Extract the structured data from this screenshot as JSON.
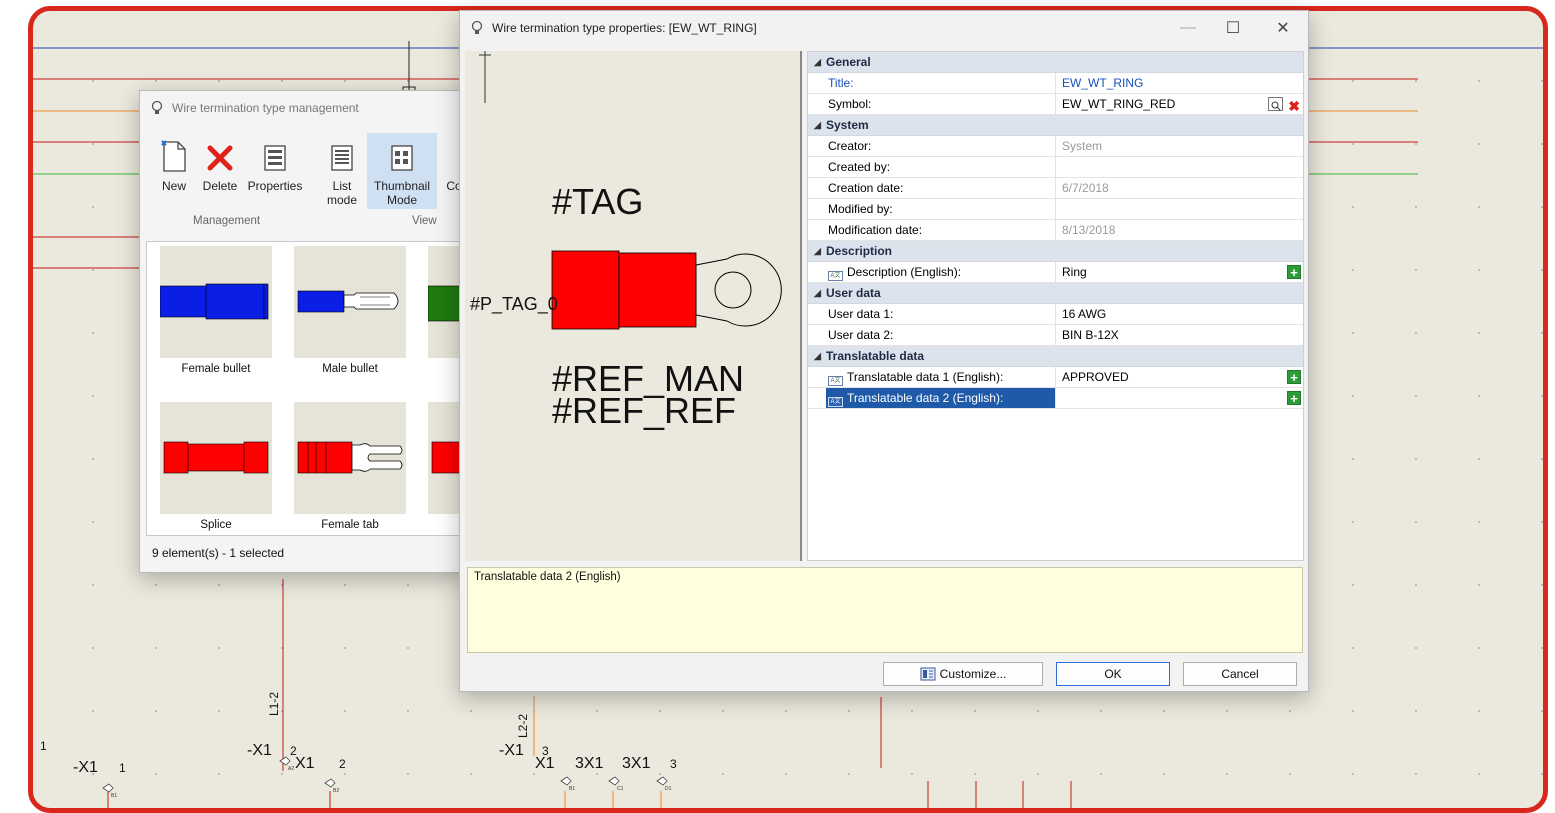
{
  "schematic": {
    "wire_labels": [
      "L1-2",
      "L2-2"
    ],
    "terminal_labels": {
      "a": "1",
      "b": "-X1",
      "c": "1",
      "d": "-X1",
      "e": "2",
      "f": "X1",
      "g": "2",
      "h": "-X1",
      "i": "3",
      "j": "X1",
      "k": "3X1",
      "l": "3X1",
      "m": "3"
    },
    "pin_labels": [
      "B1",
      "B2",
      "B1",
      "C1",
      "D1",
      "A2"
    ]
  },
  "management_window": {
    "title": "Wire termination type management",
    "buttons": {
      "new": "New",
      "delete": "Delete",
      "properties": "Properties",
      "list_mode_line1": "List",
      "list_mode_line2": "mode",
      "thumbnail_line1": "Thumbnail",
      "thumbnail_line2": "Mode",
      "co": "Co"
    },
    "groups": {
      "management": "Management",
      "view": "View"
    },
    "items": [
      {
        "label": "Female bullet",
        "color": "#0a1ee6"
      },
      {
        "label": "Male bullet",
        "color": "#0a1ee6"
      },
      {
        "label": "",
        "color": "#1f7a10"
      },
      {
        "label": "Splice",
        "color": "#ff0000"
      },
      {
        "label": "Female tab",
        "color": "#ff0000"
      },
      {
        "label": "",
        "color": "#ff0000"
      }
    ],
    "status": "9 element(s) - 1 selected"
  },
  "properties_dialog": {
    "title": "Wire termination type properties: [EW_WT_RING]",
    "controls": {
      "minimize": "—",
      "maximize": "☐",
      "close": "✕"
    },
    "preview": {
      "tag": "#TAG",
      "p_tag": "#P_TAG_0",
      "ref_man": "#REF_MAN",
      "ref_ref": "#REF_REF",
      "fill_color": "#ff0000"
    },
    "grid": {
      "general": "General",
      "title_label": "Title:",
      "title_value": "EW_WT_RING",
      "symbol_label": "Symbol:",
      "symbol_value": "EW_WT_RING_RED",
      "system": "System",
      "creator_label": "Creator:",
      "creator_value": "System",
      "created_by_label": "Created by:",
      "creation_date_label": "Creation date:",
      "creation_date_value": "6/7/2018",
      "modified_by_label": "Modified by:",
      "modification_date_label": "Modification date:",
      "modification_date_value": "8/13/2018",
      "description": "Description",
      "description_en_label": "Description (English):",
      "description_en_value": "Ring",
      "user_data": "User data",
      "user_data1_label": "User data 1:",
      "user_data1_value": "16 AWG",
      "user_data2_label": "User data 2:",
      "user_data2_value": "BIN B-12X",
      "translatable": "Translatable data",
      "trans1_label": "Translatable data 1 (English):",
      "trans1_value": "APPROVED",
      "trans2_label": "Translatable data 2 (English):",
      "trans2_value": ""
    },
    "help_text": "Translatable data 2 (English)",
    "buttons": {
      "customize": "Customize...",
      "ok": "OK",
      "cancel": "Cancel"
    }
  }
}
